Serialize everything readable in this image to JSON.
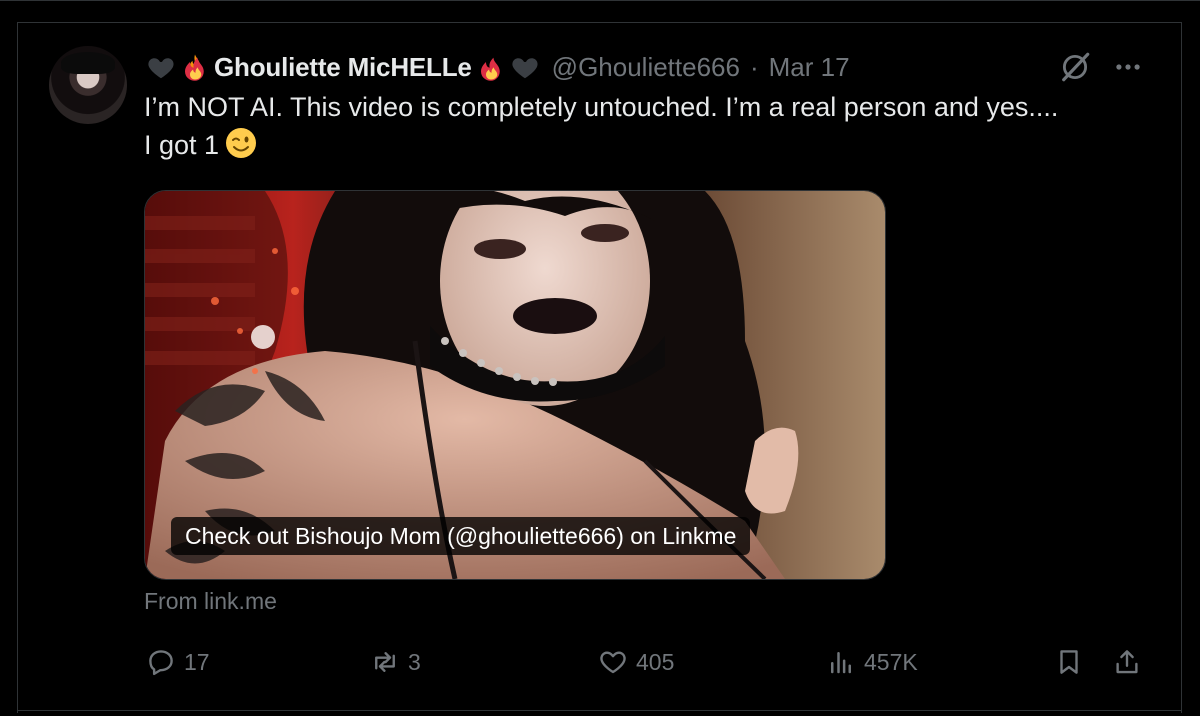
{
  "tweet": {
    "display_name": "Ghouliette MicHELLe",
    "handle": "@Ghouliette666",
    "separator": "·",
    "date": "Mar 17",
    "text_line1": "I’m NOT AI. This video is completely untouched. I’m a real person and yes....",
    "text_line2": "I got 1",
    "emoji": "wink-emoji"
  },
  "card": {
    "label": "Check out Bishoujo Mom (@ghouliette666) on Linkme",
    "source": "From link.me"
  },
  "actions": {
    "replies": "17",
    "reposts": "3",
    "likes": "405",
    "views": "457K"
  },
  "icons": [
    "heart-icon",
    "fire-icon",
    "grok-icon",
    "more-icon",
    "reply-icon",
    "repost-icon",
    "like-icon",
    "views-icon",
    "bookmark-icon",
    "share-icon"
  ],
  "colors": {
    "background": "#000000",
    "text": "#e7e9ea",
    "muted": "#71767b",
    "border": "#2f3336"
  }
}
